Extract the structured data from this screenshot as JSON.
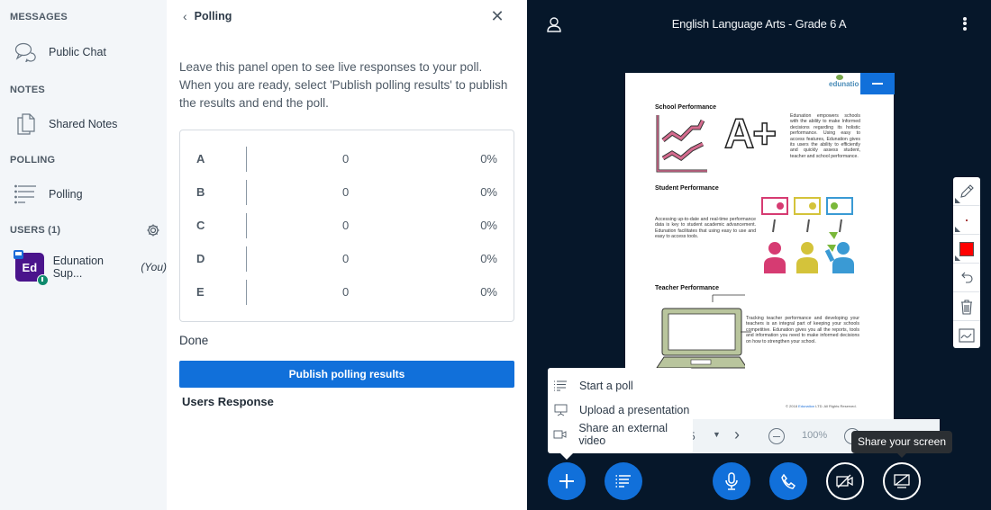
{
  "sidebar": {
    "messages_heading": "MESSAGES",
    "public_chat": "Public Chat",
    "notes_heading": "NOTES",
    "shared_notes": "Shared Notes",
    "polling_heading": "POLLING",
    "polling": "Polling",
    "users_heading": "USERS (1)",
    "user": {
      "initials": "Ed",
      "name": "Edunation Sup...",
      "you": "(You)",
      "avatar_color": "#4a148c"
    }
  },
  "panel": {
    "title": "Polling",
    "description": "Leave this panel open to see live responses to your poll. When you are ready, select 'Publish polling results' to publish the results and end the poll.",
    "results": [
      {
        "key": "A",
        "count": "0",
        "percent": "0%"
      },
      {
        "key": "B",
        "count": "0",
        "percent": "0%"
      },
      {
        "key": "C",
        "count": "0",
        "percent": "0%"
      },
      {
        "key": "D",
        "count": "0",
        "percent": "0%"
      },
      {
        "key": "E",
        "count": "0",
        "percent": "0%"
      }
    ],
    "status": "Done",
    "publish_label": "Publish polling results",
    "users_response": "Users Response"
  },
  "header": {
    "title": "English Language Arts - Grade 6 A"
  },
  "slide": {
    "logo": "edunatio",
    "school_heading": "School Performance",
    "school_text": "Edunation empowers schools with the ability to make Informed decisions regarding its holistic performance. Using easy to access features, Edunation gives its users the ability to efficiently and quickly assess student, teacher and school performance.",
    "grade": "A+",
    "student_heading": "Student Performance",
    "student_text": "Accessing up-to-date and real-time performance data is key to student academic advancement. Edunation facilitates that using easy to use and easy to access tools.",
    "teacher_heading": "Teacher Performance",
    "teacher_text": "Tracking teacher performance and developing your teachers is an integral part of keeping your schools competitive. Edunation gives you all the reports, tools and information you need to make informed decisions on how to strengthen your school.",
    "copyright_pre": "© 2018 ",
    "copyright_link": "Edunation",
    "copyright_post": " LTD. All Rights Reserved."
  },
  "slide_controls": {
    "page": "5",
    "zoom": "100%"
  },
  "whiteboard_tools": [
    "pencil",
    "thickness",
    "color",
    "undo",
    "clear",
    "multi-user"
  ],
  "whiteboard_color": "#ff0000",
  "add_menu": {
    "items": [
      "Start a poll",
      "Upload a presentation",
      "Share an external video"
    ]
  },
  "tooltip": "Share your screen",
  "colors": {
    "primary": "#1170da",
    "background": "#06172a",
    "sidebar": "#f3f6f9"
  }
}
